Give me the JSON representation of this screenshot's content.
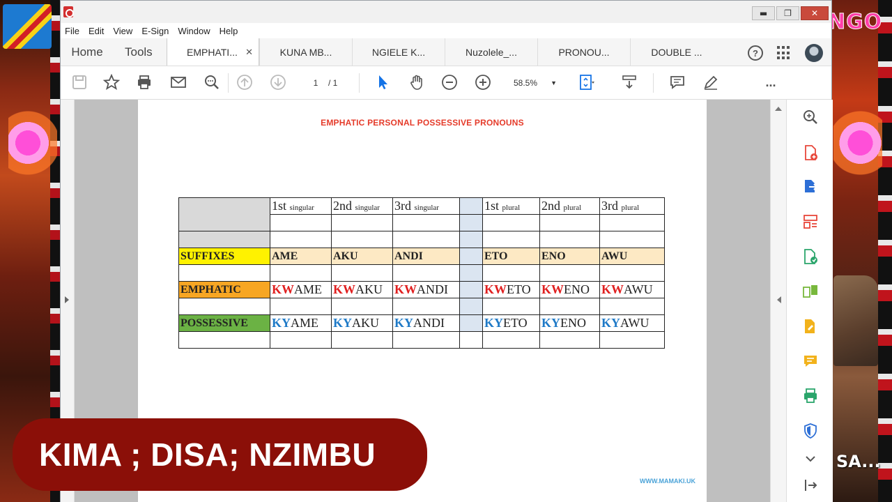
{
  "window": {
    "minimize": "▬",
    "maximize": "❐",
    "close": "✕"
  },
  "menu": [
    "File",
    "Edit",
    "View",
    "E-Sign",
    "Window",
    "Help"
  ],
  "nav": {
    "home": "Home",
    "tools": "Tools"
  },
  "tabs": [
    {
      "label": "EMPHATI...",
      "active": true
    },
    {
      "label": "KUNA MB..."
    },
    {
      "label": "NGIELE K..."
    },
    {
      "label": "Nuzolele_..."
    },
    {
      "label": "PRONOU..."
    },
    {
      "label": "DOUBLE ..."
    }
  ],
  "toolbar": {
    "page_current": "1",
    "page_total": "/ 1",
    "zoom": "58.5%",
    "more": "..."
  },
  "document": {
    "title": "EMPHATIC PERSONAL POSSESSIVE PRONOUNS",
    "website": "WWW.MAMAKI.UK",
    "headers": [
      {
        "main": "1st",
        "sub": "singular"
      },
      {
        "main": "2nd",
        "sub": "singular"
      },
      {
        "main": "3rd",
        "sub": "singular"
      },
      {
        "main": "1st",
        "sub": "plural"
      },
      {
        "main": "2nd",
        "sub": "plural"
      },
      {
        "main": "3rd",
        "sub": "plural"
      }
    ],
    "rows": {
      "suffixes": {
        "label": "SUFFIXES",
        "values": [
          "AME",
          "AKU",
          "ANDI",
          "ETO",
          "ENO",
          "AWU"
        ]
      },
      "emphatic": {
        "label": "EMPHATIC",
        "prefix": "KW",
        "values": [
          "AME",
          "AKU",
          "ANDI",
          "ETO",
          "ENO",
          "AWU"
        ]
      },
      "possessive": {
        "label": "POSSESSIVE",
        "prefix": "KY",
        "values": [
          "AME",
          "AKU",
          "ANDI",
          "ETO",
          "ENO",
          "AWU"
        ]
      }
    }
  },
  "caption": "KIMA ; DISA; NZIMBU",
  "overlay": {
    "logo_top": "NGO",
    "logo_bottom": "SA..."
  },
  "colors": {
    "title_red": "#e53b2a",
    "emphatic_prefix": "#e02020",
    "possessive_prefix": "#1f7ac7",
    "suffix_label_bg": "#fff200",
    "emphatic_label_bg": "#f7a623",
    "possessive_label_bg": "#6bb244",
    "caption_bg": "#8b0f08"
  }
}
